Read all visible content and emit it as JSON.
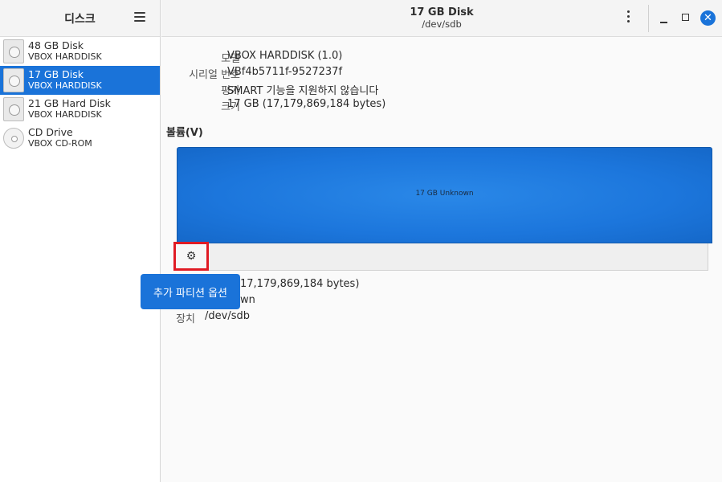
{
  "sidebar": {
    "title": "디스크",
    "disks": [
      {
        "name": "48 GB Disk",
        "sub": "VBOX HARDDISK"
      },
      {
        "name": "17 GB Disk",
        "sub": "VBOX HARDDISK"
      },
      {
        "name": "21 GB Hard Disk",
        "sub": "VBOX HARDDISK"
      },
      {
        "name": "CD Drive",
        "sub": "VBOX CD-ROM"
      }
    ]
  },
  "header": {
    "title": "17 GB Disk",
    "subtitle": "/dev/sdb",
    "close_glyph": "✕"
  },
  "info": {
    "model_label": "모델",
    "model_value": "VBOX HARDDISK (1.0)",
    "serial_label": "시리얼 번호",
    "serial_value": "VBf4b5711f-9527237f",
    "rating_label": "평가",
    "rating_value": "SMART 기능을 지원하지 않습니다",
    "size_label": "크기",
    "size_value": "17 GB (17,179,869,184 bytes)"
  },
  "volumes": {
    "title": "볼륨(V)",
    "bar_label": "17 GB Unknown",
    "gear_glyph": "⚙",
    "tooltip": "추가 파티션 옵션",
    "size_value_partial": "17,179,869,184 bytes)",
    "contents_value_partial": "wn",
    "device_label": "장치",
    "device_value": "/dev/sdb"
  },
  "colors": {
    "accent": "#1a73d9",
    "highlight": "#e01b24"
  }
}
